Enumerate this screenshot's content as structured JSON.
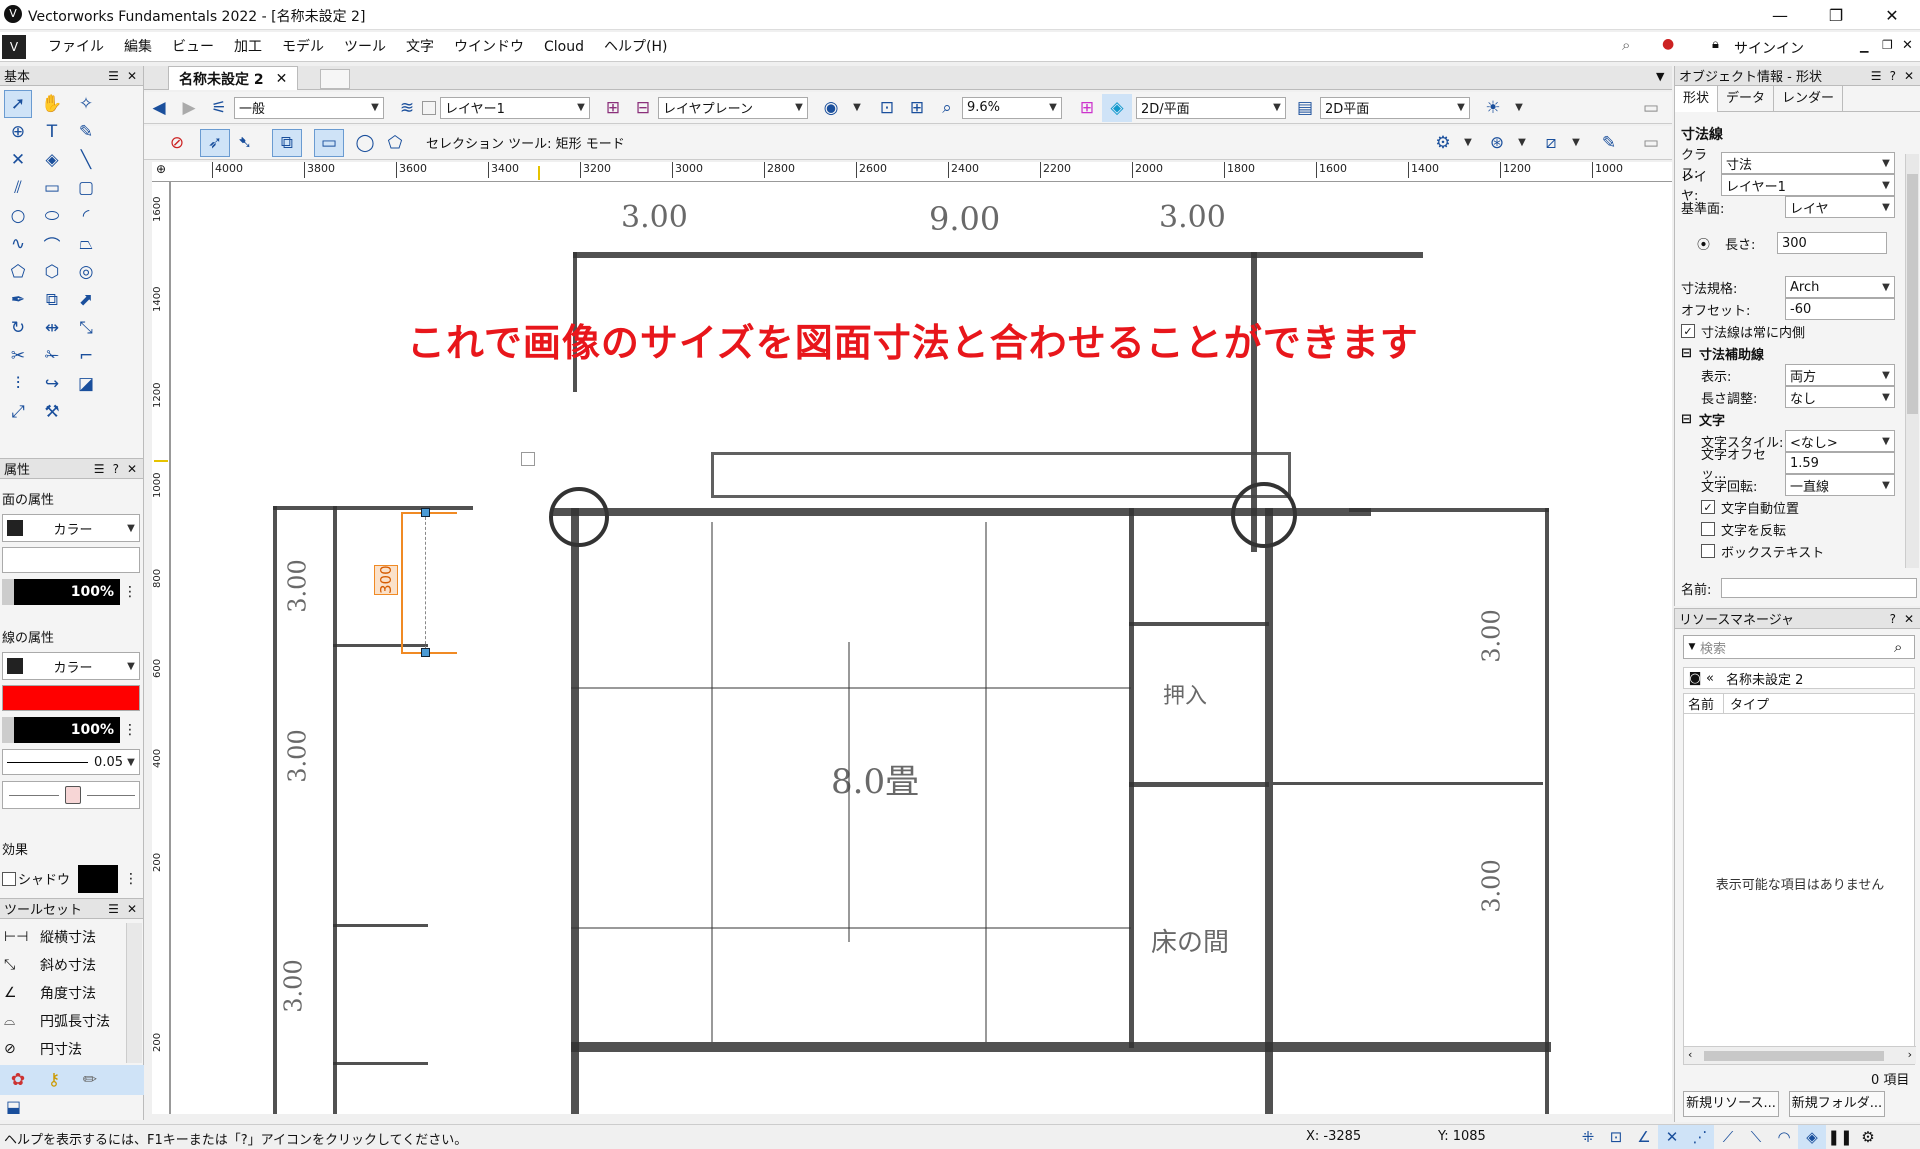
{
  "window": {
    "title": "Vectorworks Fundamentals 2022 - [名称未設定 2]",
    "signin": "サインイン"
  },
  "menu": [
    "ファイル",
    "編集",
    "ビュー",
    "加工",
    "モデル",
    "ツール",
    "文字",
    "ウインドウ",
    "Cloud",
    "ヘルプ(H)"
  ],
  "doc_tab": "名称未設定 2",
  "toolbar": {
    "class_value": "一般",
    "layer_value": "レイヤー1",
    "layer_plane": "レイヤプレーン",
    "zoom": "9.6%",
    "view": "2D/平面",
    "render": "2D平面",
    "mode_label": "セレクション ツール: 矩形 モード"
  },
  "ruler_top": [
    "4000",
    "3800",
    "3600",
    "3400",
    "3200",
    "3000",
    "2800",
    "2600",
    "2400",
    "2200",
    "2000",
    "1800",
    "1600",
    "1400",
    "1200",
    "1000"
  ],
  "ruler_left": [
    "1600",
    "1400",
    "1200",
    "1000",
    "800",
    "600",
    "400",
    "200",
    "200"
  ],
  "left": {
    "basic_title": "基本",
    "attr_title": "属性",
    "face_attr": "面の属性",
    "face_color": "カラー",
    "face_opacity": "100%",
    "line_attr": "線の属性",
    "line_color": "カラー",
    "line_opacity": "100%",
    "line_weight": "0.05",
    "effects": "効果",
    "shadow": "シャドウ",
    "toolset_title": "ツールセット",
    "toolset": [
      "縦横寸法",
      "斜め寸法",
      "角度寸法",
      "円弧長寸法",
      "円寸法"
    ]
  },
  "canvas": {
    "overlay_text": "これで画像のサイズを図面寸法と合わせることができます",
    "dimension_value": "300",
    "hand_labels": [
      "3.00",
      "9.00",
      "3.00",
      "3.00",
      "3.00",
      "3.00",
      "3.00",
      "3.00",
      "8.0畳",
      "押入",
      "床の間"
    ]
  },
  "oip": {
    "title": "オブジェクト情報 - 形状",
    "tabs": [
      "形状",
      "データ",
      "レンダー"
    ],
    "object_type": "寸法線",
    "class_label": "クラス:",
    "class_value": "寸法",
    "layer_label": "レイヤ:",
    "layer_value": "レイヤー1",
    "plane_label": "基準面:",
    "plane_value": "レイヤ",
    "length_label": "長さ:",
    "length_value": "300",
    "std_label": "寸法規格:",
    "std_value": "Arch",
    "offset_label": "オフセット:",
    "offset_value": "-60",
    "always_inside": "寸法線は常に内側",
    "aux_section": "寸法補助線",
    "display_label": "表示:",
    "display_value": "両方",
    "adjust_label": "長さ調整:",
    "adjust_value": "なし",
    "text_section": "文字",
    "textstyle_label": "文字スタイル:",
    "textstyle_value": "<なし>",
    "textoffset_label": "文字オフセッ...",
    "textoffset_value": "1.59",
    "textrot_label": "文字回転:",
    "textrot_value": "一直線",
    "auto_pos": "文字自動位置",
    "flip_text": "文字を反転",
    "box_text": "ボックステキスト",
    "name_label": "名前:"
  },
  "resource": {
    "title": "リソースマネージャ",
    "search_placeholder": "検索",
    "file": "名称未設定 2",
    "col_name": "名前",
    "col_type": "タイプ",
    "empty": "表示可能な項目はありません",
    "count": "0 項目",
    "new_resource": "新規リソース...",
    "new_folder": "新規フォルダ..."
  },
  "status": {
    "help": "ヘルプを表示するには、F1キーまたは「?」アイコンをクリックしてください。",
    "x": "X: -3285",
    "y": "Y: 1085"
  },
  "colors": {
    "overlay": "#e8161b",
    "dimension": "#f08a24",
    "accent": "#cfe3f7",
    "line_red": "#ff0000"
  }
}
